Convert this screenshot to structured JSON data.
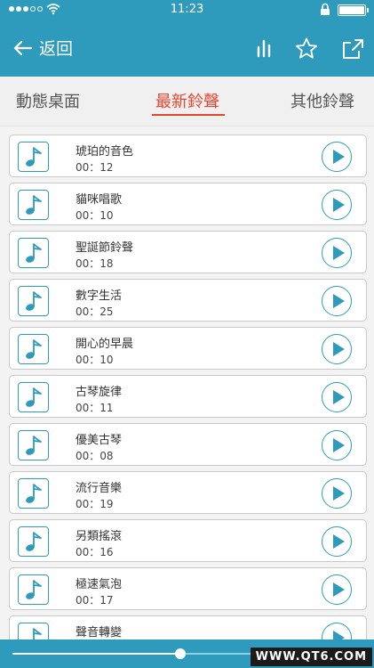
{
  "status_bar": {
    "time": "11:23"
  },
  "nav": {
    "back_label": "返回"
  },
  "tabs": [
    {
      "label": "動態桌面",
      "active": false
    },
    {
      "label": "最新鈴聲",
      "active": true
    },
    {
      "label": "其他鈴聲",
      "active": false
    }
  ],
  "ringtones": [
    {
      "title": "琥珀的音色",
      "duration": "00：12"
    },
    {
      "title": "貓咪唱歌",
      "duration": "00：10"
    },
    {
      "title": "聖誕節鈴聲",
      "duration": "00：18"
    },
    {
      "title": "數字生活",
      "duration": "00：25"
    },
    {
      "title": "開心的早晨",
      "duration": "00：10"
    },
    {
      "title": "古琴旋律",
      "duration": "00：11"
    },
    {
      "title": "優美古琴",
      "duration": "00：08"
    },
    {
      "title": "流行音樂",
      "duration": "00：19"
    },
    {
      "title": "另類搖滾",
      "duration": "00：16"
    },
    {
      "title": "極速氣泡",
      "duration": "00：17"
    },
    {
      "title": "聲音轉變",
      "duration": ""
    }
  ],
  "player": {
    "progress": 0.54
  },
  "watermark": "WWW.QT6.COM",
  "colors": {
    "accent": "#2e9bbc",
    "active_tab": "#e8452f"
  }
}
